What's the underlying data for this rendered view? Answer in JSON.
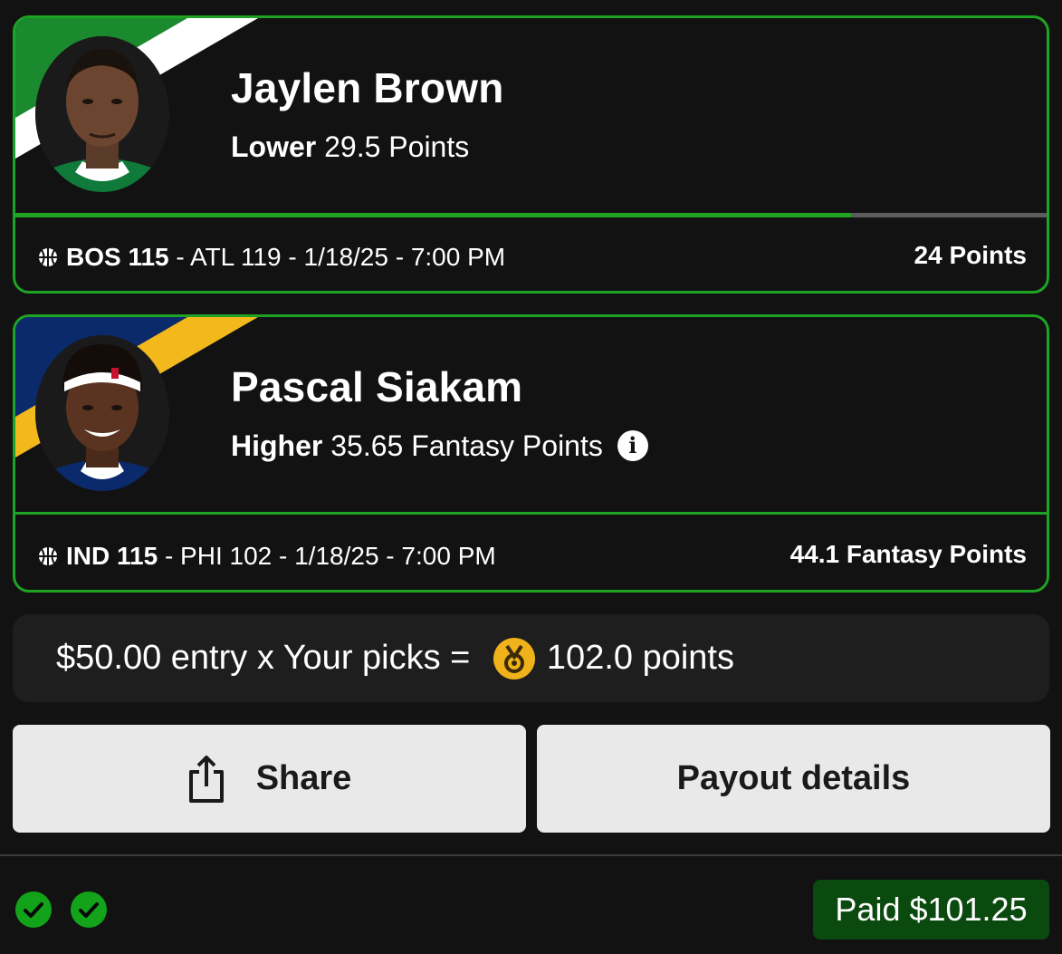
{
  "picks": [
    {
      "player_name": "Jaylen Brown",
      "direction": "Lower",
      "line": "29.5 Points",
      "team_colors": [
        "#1b8a2e",
        "#ffffff"
      ],
      "home_label": "BOS 115",
      "game_rest": " - ATL 119 - 1/18/25 - 7:00 PM",
      "result": "24 Points",
      "progress": 0.81,
      "show_info": false
    },
    {
      "player_name": "Pascal Siakam",
      "direction": "Higher",
      "line": "35.65 Fantasy Points",
      "team_colors": [
        "#0b2a6b",
        "#f2b81c"
      ],
      "home_label": "IND 115",
      "game_rest": " - PHI 102 - 1/18/25 - 7:00 PM",
      "result": "44.1 Fantasy Points",
      "show_info": true
    }
  ],
  "summary": {
    "prefix": "$50.00 entry x Your picks = ",
    "points": "102.0 points",
    "icon": "medal-icon"
  },
  "buttons": {
    "share_label": "Share",
    "payout_label": "Payout details"
  },
  "footer": {
    "checks": [
      "check-icon",
      "check-icon"
    ],
    "paid_label": "Paid $101.25"
  },
  "colors": {
    "accent_green": "#1fa324",
    "paid_bg": "#0b4a0f",
    "button_bg": "#e9e9e9"
  }
}
